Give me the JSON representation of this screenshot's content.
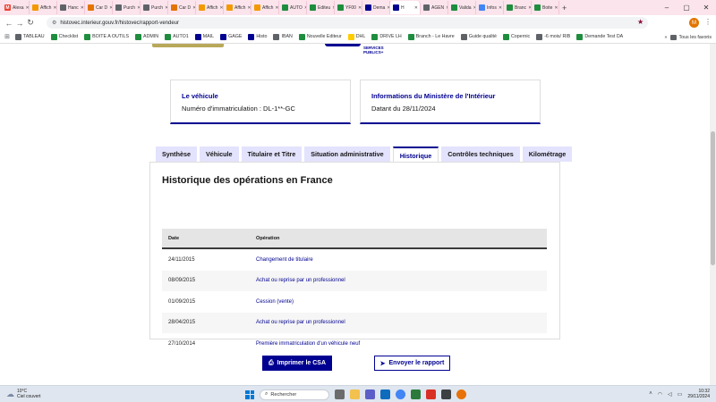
{
  "browser": {
    "tabs": [
      {
        "label": "Alexa",
        "icon": "gmail-icon",
        "color": "#ea4335",
        "glyph": "M"
      },
      {
        "label": "Affich",
        "icon": "bookmark-icon",
        "color": "#f29900",
        "glyph": ""
      },
      {
        "label": "Hanc",
        "icon": "globe-icon",
        "color": "#5f6368",
        "glyph": ""
      },
      {
        "label": "Car D",
        "icon": "carfax-icon",
        "color": "#e37400",
        "glyph": ""
      },
      {
        "label": "Purch",
        "icon": "globe-icon",
        "color": "#5f6368",
        "glyph": ""
      },
      {
        "label": "Purch",
        "icon": "globe-icon",
        "color": "#5f6368",
        "glyph": ""
      },
      {
        "label": "Car D",
        "icon": "carfax-icon",
        "color": "#e37400",
        "glyph": ""
      },
      {
        "label": "Affich",
        "icon": "bookmark-icon",
        "color": "#f29900",
        "glyph": ""
      },
      {
        "label": "Affich",
        "icon": "bookmark-icon",
        "color": "#f29900",
        "glyph": ""
      },
      {
        "label": "Affich",
        "icon": "bookmark-icon",
        "color": "#f29900",
        "glyph": ""
      },
      {
        "label": "AUTO",
        "icon": "sheet-icon",
        "color": "#1e8e3e",
        "glyph": ""
      },
      {
        "label": "Editeu",
        "icon": "sheet-icon",
        "color": "#1e8e3e",
        "glyph": ""
      },
      {
        "label": "YF00",
        "icon": "sheet-icon",
        "color": "#1e8e3e",
        "glyph": ""
      },
      {
        "label": "Dema",
        "icon": "flag-icon",
        "color": "#000091",
        "glyph": ""
      },
      {
        "label": "H",
        "icon": "flag-icon",
        "color": "#000091",
        "glyph": "",
        "active": true
      },
      {
        "label": "AGEN",
        "icon": "globe-icon",
        "color": "#5f6368",
        "glyph": ""
      },
      {
        "label": "Valida",
        "icon": "sheet-icon",
        "color": "#1e8e3e",
        "glyph": ""
      },
      {
        "label": "Infos",
        "icon": "doc-icon",
        "color": "#4285f4",
        "glyph": ""
      },
      {
        "label": "Branc",
        "icon": "sheet-icon",
        "color": "#1e8e3e",
        "glyph": ""
      },
      {
        "label": "Boite",
        "icon": "sheet-icon",
        "color": "#1e8e3e",
        "glyph": ""
      }
    ],
    "url": "histovec.interieur.gouv.fr/histovec/rapport-vendeur",
    "profile_initial": "M",
    "bookmarks": [
      {
        "label": "TABLEAU",
        "color": "#5f6368"
      },
      {
        "label": "Checklist",
        "color": "#1e8e3e"
      },
      {
        "label": "BOITE A OUTILS",
        "color": "#1e8e3e"
      },
      {
        "label": "ADMIN",
        "color": "#1e8e3e"
      },
      {
        "label": "AUTO1",
        "color": "#1e8e3e"
      },
      {
        "label": "MAIL",
        "color": "#000091"
      },
      {
        "label": "GAGE",
        "color": "#000091"
      },
      {
        "label": "Histo",
        "color": "#000091"
      },
      {
        "label": "IBAN",
        "color": "#5f6368"
      },
      {
        "label": "Nouvelle Editeur",
        "color": "#1e8e3e"
      },
      {
        "label": "DHL",
        "color": "#ffcc00"
      },
      {
        "label": "DRIVE LH",
        "color": "#1e8e3e"
      },
      {
        "label": "Branch - Le Havre",
        "color": "#1e8e3e"
      },
      {
        "label": "Guide qualité",
        "color": "#5f6368"
      },
      {
        "label": "Copernic",
        "color": "#1e8e3e"
      },
      {
        "label": "-6 mois/ RIB",
        "color": "#5f6368"
      },
      {
        "label": "Demande Test DA",
        "color": "#1e8e3e"
      }
    ],
    "all_bookmarks_label": "Tous les favoris"
  },
  "page": {
    "logo_text_line1": "SERVICES",
    "logo_text_line2": "PUBLICS+",
    "vehicle_card": {
      "title": "Le véhicule",
      "value": "Numéro d'immatriculation : DL-1**-GC"
    },
    "ministry_card": {
      "title": "Informations du Ministère de l'Intérieur",
      "value": "Datant du 28/11/2024"
    },
    "tabs": [
      {
        "label": "Synthèse",
        "active": false
      },
      {
        "label": "Véhicule",
        "active": false
      },
      {
        "label": "Titulaire et Titre",
        "active": false
      },
      {
        "label": "Situation administrative",
        "active": false
      },
      {
        "label": "Historique",
        "active": true
      },
      {
        "label": "Contrôles techniques",
        "active": false
      },
      {
        "label": "Kilométrage",
        "active": false
      }
    ],
    "history": {
      "title": "Historique des opérations en France",
      "columns": [
        "Date",
        "Opération"
      ],
      "rows": [
        {
          "date": "24/11/2015",
          "operation": "Changement de titulaire"
        },
        {
          "date": "08/09/2015",
          "operation": "Achat ou reprise par un professionnel"
        },
        {
          "date": "01/09/2015",
          "operation": "Cession (vente)"
        },
        {
          "date": "28/04/2015",
          "operation": "Achat ou reprise par un professionnel"
        },
        {
          "date": "27/10/2014",
          "operation": "Première immatriculation d'un véhicule neuf"
        }
      ]
    },
    "print_button": "Imprimer le CSA",
    "send_button": "Envoyer le rapport"
  },
  "taskbar": {
    "weather_temp": "10°C",
    "weather_desc": "Ciel couvert",
    "search_placeholder": "Rechercher",
    "time": "10:32",
    "date": "29/11/2024"
  },
  "colors": {
    "accent": "#000091",
    "tab_inactive_bg": "#e3e3fd"
  }
}
